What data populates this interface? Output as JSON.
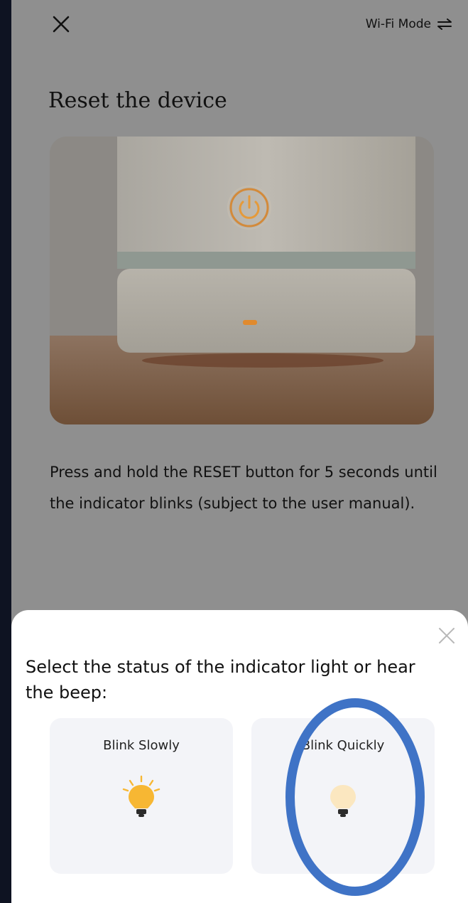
{
  "header": {
    "close_icon": "close-icon",
    "wifi_mode_label": "Wi-Fi Mode",
    "switch_icon": "switch-arrows-icon"
  },
  "page": {
    "title": "Reset the device",
    "description": "Press and hold the RESET button for 5 seconds until the indicator blinks (subject to the user manual)."
  },
  "sheet": {
    "title": "Select the status of the indicator light or hear the beep:",
    "options": [
      {
        "label": "Blink Slowly",
        "icon": "bulb-lit-icon"
      },
      {
        "label": "Blink Quickly",
        "icon": "bulb-dim-icon"
      }
    ]
  },
  "colors": {
    "backdrop": "#0e1322",
    "overlay_page": "#8f8f8f",
    "sheet_bg": "#ffffff",
    "option_bg": "#f3f4f8",
    "accent_led": "#e08a2e",
    "bulb_lit": "#f7b733",
    "highlight_ring": "#3f73c6"
  }
}
